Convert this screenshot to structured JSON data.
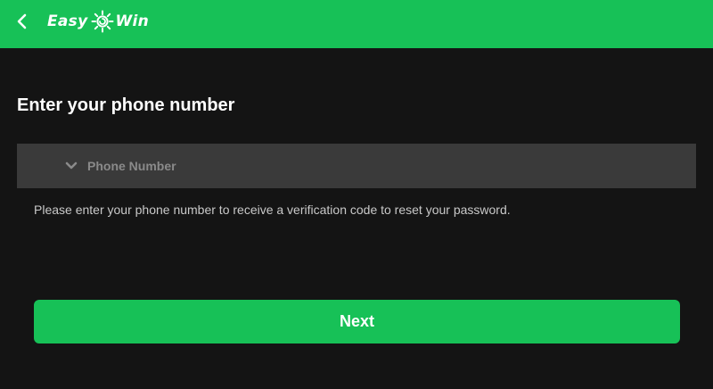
{
  "header": {
    "logo_left": "Easy",
    "logo_right": "Win",
    "logo_icon": "sun-icon",
    "back_icon": "chevron-left-icon",
    "bg_color": "#17c157"
  },
  "main": {
    "title": "Enter your phone number",
    "phone_field": {
      "placeholder": "Phone Number",
      "value": "",
      "dropdown_icon": "chevron-down-icon"
    },
    "helper_text": "Please enter your phone number to receive a verification code to reset your password.",
    "next_button": {
      "label": "Next",
      "color": "#17c157"
    }
  }
}
